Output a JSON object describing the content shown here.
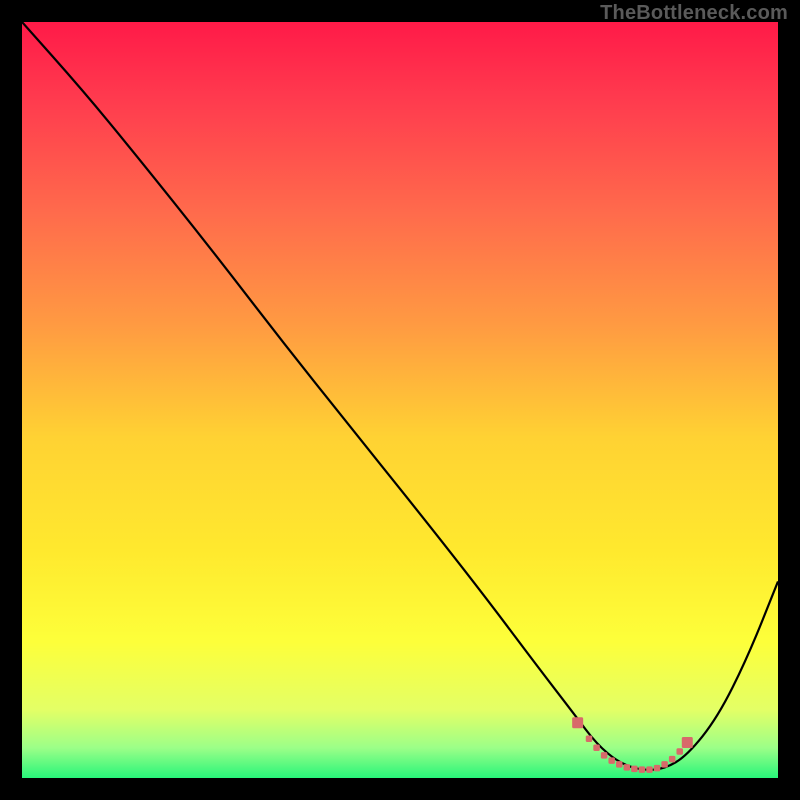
{
  "watermark": "TheBottleneck.com",
  "chart_data": {
    "type": "line",
    "title": "",
    "xlabel": "",
    "ylabel": "",
    "xlim": [
      0,
      100
    ],
    "ylim": [
      0,
      100
    ],
    "series": [
      {
        "name": "bottleneck-curve",
        "color": "#000000",
        "x": [
          0,
          8,
          15,
          25,
          35,
          45,
          55,
          62,
          68,
          73,
          76,
          79,
          82,
          85,
          88,
          92,
          96,
          100
        ],
        "y": [
          100,
          91,
          82.5,
          70,
          57,
          44.5,
          32,
          23,
          15,
          8.5,
          4.5,
          2,
          1,
          1.2,
          3,
          8,
          16,
          26
        ]
      },
      {
        "name": "optimal-band-markers",
        "color": "#d86a6a",
        "style": "dots",
        "x": [
          73.5,
          75,
          76,
          77,
          78,
          79,
          80,
          81,
          82,
          83,
          84,
          85,
          86,
          87,
          88
        ],
        "y": [
          7.3,
          5.2,
          4,
          3,
          2.3,
          1.8,
          1.4,
          1.2,
          1.1,
          1.1,
          1.3,
          1.8,
          2.5,
          3.5,
          4.7
        ]
      }
    ],
    "background_gradient": {
      "type": "linear-vertical",
      "stops": [
        {
          "pos": 0.0,
          "color": "#ff1a48"
        },
        {
          "pos": 0.1,
          "color": "#ff3a4e"
        },
        {
          "pos": 0.25,
          "color": "#ff6a4c"
        },
        {
          "pos": 0.4,
          "color": "#ff9a42"
        },
        {
          "pos": 0.55,
          "color": "#ffd233"
        },
        {
          "pos": 0.7,
          "color": "#ffe92e"
        },
        {
          "pos": 0.82,
          "color": "#fdff3a"
        },
        {
          "pos": 0.91,
          "color": "#e3ff66"
        },
        {
          "pos": 0.96,
          "color": "#9cff88"
        },
        {
          "pos": 1.0,
          "color": "#28f57a"
        }
      ]
    }
  }
}
